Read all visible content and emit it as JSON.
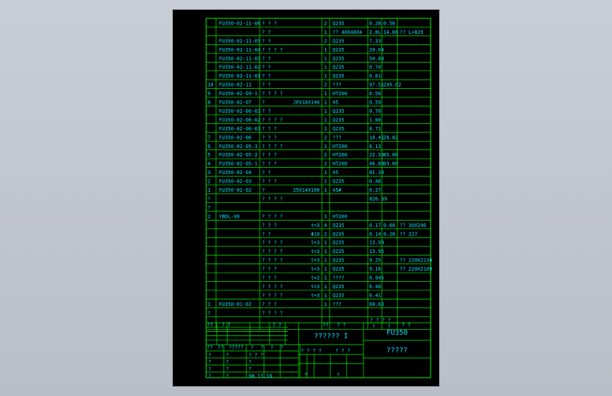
{
  "bom": {
    "rows": [
      {
        "seq": "",
        "code": "FU350-02-11-06",
        "name": "?  ?  ?",
        "spec": "",
        "qty": "2",
        "mat": "Q235",
        "w1": "0.28",
        "w2": "0.56",
        "note": ""
      },
      {
        "seq": "",
        "code": "",
        "name": "?     ?",
        "spec": "",
        "qty": "1",
        "mat": "?? 40X40X4",
        "w1": "2.0L",
        "w2": "14.66",
        "note": "?? L=829"
      },
      {
        "seq": "",
        "code": "FU350-02-11-05",
        "name": "?     ?",
        "spec": "",
        "qty": "2",
        "mat": "Q235",
        "w1": "7.33",
        "w2": "",
        "note": ""
      },
      {
        "seq": "",
        "code": "FU350-02-11-04",
        "name": "? ? ? ?",
        "spec": "",
        "qty": "1",
        "mat": "Q235",
        "w1": "20.04",
        "w2": "",
        "note": ""
      },
      {
        "seq": "",
        "code": "FU350-02-11-03",
        "name": "?     ?",
        "spec": "",
        "qty": "1",
        "mat": "Q235",
        "w1": "54.89",
        "w2": "",
        "note": ""
      },
      {
        "seq": "",
        "code": "FU350-02-11-02",
        "name": "?     ?",
        "spec": "",
        "qty": "1",
        "mat": "Q235",
        "w1": "0.70",
        "w2": "",
        "note": ""
      },
      {
        "seq": "",
        "code": "FU350-02-11-01",
        "name": "?     ?",
        "spec": "",
        "qty": "1",
        "mat": "Q235",
        "w1": "0.61",
        "w2": "",
        "note": ""
      },
      {
        "seq": "10",
        "code": "FU350-02-11",
        "name": "?     ?",
        "spec": "",
        "qty": "2",
        "mat": "???",
        "w1": "97.51",
        "w2": "195.02",
        "note": ""
      },
      {
        "seq": "9",
        "code": "FU350-02-09-1",
        "name": "? ? ? ?",
        "spec": "",
        "qty": "1",
        "mat": "HT200",
        "w1": "6.56",
        "w2": "",
        "note": ""
      },
      {
        "seq": "8",
        "code": "FU350-02-07",
        "name": "?",
        "spec": "JPX18X140",
        "qty": "1",
        "mat": "45",
        "w1": "0.59",
        "w2": "",
        "note": ""
      },
      {
        "seq": "",
        "code": "FU350-02-06-03",
        "name": "?     ?",
        "spec": "",
        "qty": "1",
        "mat": "Q235",
        "w1": "0.70",
        "w2": "",
        "note": ""
      },
      {
        "seq": "",
        "code": "FU350-02-06-02",
        "name": "? ? ? ?",
        "spec": "",
        "qty": "1",
        "mat": "Q235",
        "w1": "1.00",
        "w2": "",
        "note": ""
      },
      {
        "seq": "",
        "code": "FU350-02-06-01",
        "name": "?  ?  ?",
        "spec": "",
        "qty": "1",
        "mat": "Q235",
        "w1": "8.71",
        "w2": "",
        "note": ""
      },
      {
        "seq": "7",
        "code": "FU350-02-06",
        "name": "?  ?  ?",
        "spec": "",
        "qty": "2",
        "mat": "???",
        "w1": "10.41",
        "w2": "20.82",
        "note": ""
      },
      {
        "seq": "6",
        "code": "FU350-02-05-3",
        "name": "? ? ? ?",
        "spec": "",
        "qty": "1",
        "mat": "HT200",
        "w1": "6.13",
        "w2": "",
        "note": ""
      },
      {
        "seq": "5",
        "code": "FU350-02-05-2",
        "name": "?  ?  ?",
        "spec": "",
        "qty": "2",
        "mat": "HT200",
        "w1": "22.50",
        "w2": "45.00",
        "note": ""
      },
      {
        "seq": "4",
        "code": "FU350-02-05-1",
        "name": "?  ?  ?",
        "spec": "",
        "qty": "2",
        "mat": "HT200",
        "w1": "46.80",
        "w2": "93.60",
        "note": ""
      },
      {
        "seq": "3",
        "code": "FU350-02-04",
        "name": "?     ?",
        "spec": "",
        "qty": "1",
        "mat": "45",
        "w1": "81.39",
        "w2": "",
        "note": ""
      },
      {
        "seq": "2",
        "code": "FU350-02-03",
        "name": "?  ?  ?",
        "spec": "",
        "qty": "1",
        "mat": "Q235",
        "w1": "0.48",
        "w2": "",
        "note": ""
      },
      {
        "seq": "1",
        "code": "FU350-02-02",
        "name": "?",
        "spec": "25X14X100",
        "qty": "1",
        "mat": "45#",
        "w1": "0.27",
        "w2": "",
        "note": ""
      },
      {
        "seq": "?",
        "code": "",
        "name": "  ? ? ? ?",
        "spec": "",
        "qty": "",
        "mat": "",
        "w1": "826.39",
        "w2": "",
        "note": ""
      },
      {
        "seq": "?",
        "code": "",
        "name": "",
        "spec": "",
        "qty": "",
        "mat": "",
        "w1": "",
        "w2": "",
        "note": ""
      },
      {
        "seq": "2",
        "code": "YBDL-00",
        "name": "? ? ? ?",
        "spec": "",
        "qty": "1",
        "mat": "HT200",
        "w1": "",
        "w2": "",
        "note": ""
      },
      {
        "seq": "",
        "code": "",
        "name": "?  ?  ?",
        "spec": "t=3",
        "qty": "4",
        "mat": "Q235",
        "w1": "0.17",
        "w2": "0.68",
        "note": "?? 30X246"
      },
      {
        "seq": "",
        "code": "",
        "name": "?     ?",
        "spec": "Φ10",
        "qty": "2",
        "mat": "Q235",
        "w1": "0.14",
        "w2": "0.28",
        "note": "?? 227"
      },
      {
        "seq": "",
        "code": "",
        "name": "? ? ? ?",
        "spec": "t=3",
        "qty": "1",
        "mat": "Q235",
        "w1": "13.99",
        "w2": "",
        "note": ""
      },
      {
        "seq": "",
        "code": "",
        "name": "? ? ? ?",
        "spec": "t=3",
        "qty": "1",
        "mat": "Q235",
        "w1": "13.95",
        "w2": "",
        "note": ""
      },
      {
        "seq": "",
        "code": "",
        "name": "? ? ? ?",
        "spec": "t=3",
        "qty": "1",
        "mat": "Q235",
        "w1": "9.25",
        "w2": "",
        "note": "?? 220X2134"
      },
      {
        "seq": "",
        "code": "",
        "name": "?  ?  ?",
        "spec": "t=3",
        "qty": "1",
        "mat": "Q235",
        "w1": "9.16",
        "w2": "",
        "note": "?? 220X2109"
      },
      {
        "seq": "",
        "code": "",
        "name": "?  ?  ?",
        "spec": "t=2",
        "qty": "1",
        "mat": "????",
        "w1": "0.045",
        "w2": "",
        "note": ""
      },
      {
        "seq": "",
        "code": "",
        "name": "? ? ? ?",
        "spec": "t=3",
        "qty": "1",
        "mat": "Q235",
        "w1": "6.48",
        "w2": "",
        "note": ""
      },
      {
        "seq": "",
        "code": "",
        "name": "? ? ? ?",
        "spec": "t=3",
        "qty": "1",
        "mat": "Q235",
        "w1": "6.41",
        "w2": "",
        "note": ""
      },
      {
        "seq": "1",
        "code": "FU350-01-02",
        "name": "?  ?  ?",
        "spec": "",
        "qty": "1",
        "mat": "???",
        "w1": "60.63",
        "w2": "",
        "note": ""
      },
      {
        "seq": "?",
        "code": "",
        "name": "? ? ? ?",
        "spec": "",
        "qty": "",
        "mat": "",
        "w1": "",
        "w2": "",
        "note": ""
      }
    ],
    "header": {
      "seq": "??",
      "code": "?    ?",
      "name": "?         ?",
      "qty": "??",
      "mat": "?    ?",
      "w": "? ? ? ?",
      "w_sub1": "?",
      "w_sub2": "?",
      "note": "?    ?"
    }
  },
  "title_block": {
    "drawing_title": "??????  I",
    "model": "FU350",
    "company": "?????",
    "rev_labels": [
      "??",
      "??",
      "?????",
      "?",
      "?",
      "?",
      "?"
    ],
    "left_labels": [
      [
        "?",
        "?",
        "? ? ?"
      ],
      [
        "?",
        "?",
        "?"
      ],
      [
        "?",
        "?",
        "?"
      ],
      [
        "?",
        "?",
        "98.11.16"
      ]
    ],
    "mid_labels": [
      "? ? ? ?",
      "? ? ?",
      "?",
      "?"
    ],
    "date": "98.11.16"
  }
}
